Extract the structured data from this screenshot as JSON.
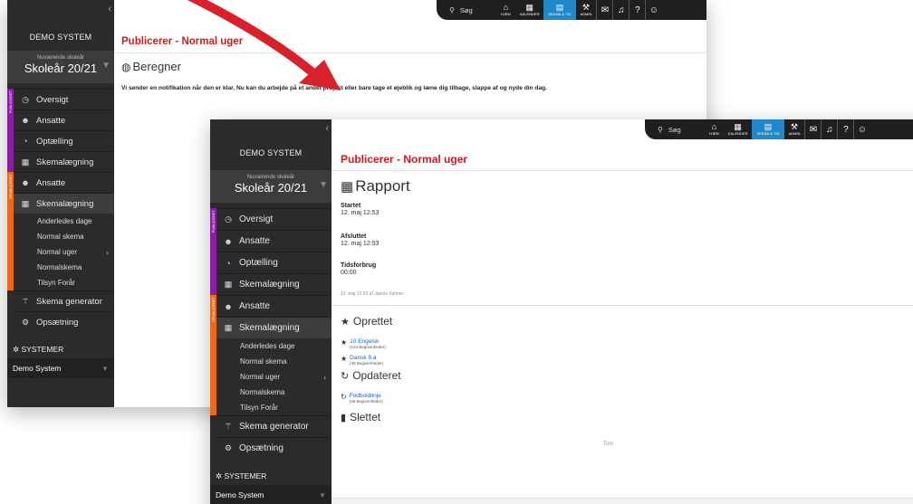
{
  "colors": {
    "sidebar_bg": "#2b2b2b",
    "accent_purple": "#8a1fa1",
    "accent_orange": "#e86b1c",
    "header_red": "#d0191f",
    "topbar_selected": "#1e88c8",
    "arrow_red": "#d8222b"
  },
  "sidebar": {
    "system_name": "DEMO SYSTEM",
    "year_label": "Nuværende skoleår",
    "year_value": "Skoleår 20/21",
    "group_tag_published": "PUBLICERET",
    "group_tag_unpublished": "UPUBLICERET",
    "items_group1": [
      "Oversigt",
      "Ansatte",
      "Optælling",
      "Skemalægning"
    ],
    "items_group2": [
      "Ansatte",
      "Skemalægning"
    ],
    "subitems": [
      "Anderledes dage",
      "Normal skema",
      "Normal uger",
      "Normalskema",
      "Tilsyn Forår"
    ],
    "skema_generator": "Skema generator",
    "opsaetning": "Opsætning",
    "systemer": "SYSTEMER",
    "demo_system": "Demo System"
  },
  "topbar": {
    "search_label": "Søg",
    "buttons": [
      {
        "label": "HJEM",
        "icon": "home-icon"
      },
      {
        "label": "KALENDER",
        "icon": "calendar-icon"
      },
      {
        "label": "SKEMA & TID",
        "icon": "schedule-icon"
      },
      {
        "label": "ADMIN",
        "icon": "admin-icon"
      }
    ],
    "round_icons": [
      "mail-icon",
      "bell-icon",
      "help-icon",
      "user-icon"
    ]
  },
  "window_back": {
    "page_header": "Publicerer - Normal uger",
    "section_title": "Beregner",
    "notification": "Vi sender en notifikation når den er klar. Nu kan du arbejde på et andet projekt eller bare tage et øjeblik og læne dig tilbage, slappe af og nyde din dag."
  },
  "window_front": {
    "page_header": "Publicerer - Normal uger",
    "section_title": "Rapport",
    "started_label": "Startet",
    "started_value": "12. maj 12:53",
    "ended_label": "Afsluttet",
    "ended_value": "12. maj 12:53",
    "time_label": "Tidsforbrug",
    "time_value": "00:00",
    "by_line": "12. maj 12:53 af Jannie Schnor",
    "created_title": "Oprettet",
    "created": [
      {
        "name": "10 Engelsk",
        "note": "(144 Begivenheder)"
      },
      {
        "name": "Dansk 9.a",
        "note": "(36 Begivenheder)"
      }
    ],
    "updated_title": "Opdateret",
    "updated": [
      {
        "name": "Fodboldlinje",
        "note": "(36 Begivenheder)"
      }
    ],
    "deleted_title": "Slettet",
    "empty_label": "Tom"
  }
}
